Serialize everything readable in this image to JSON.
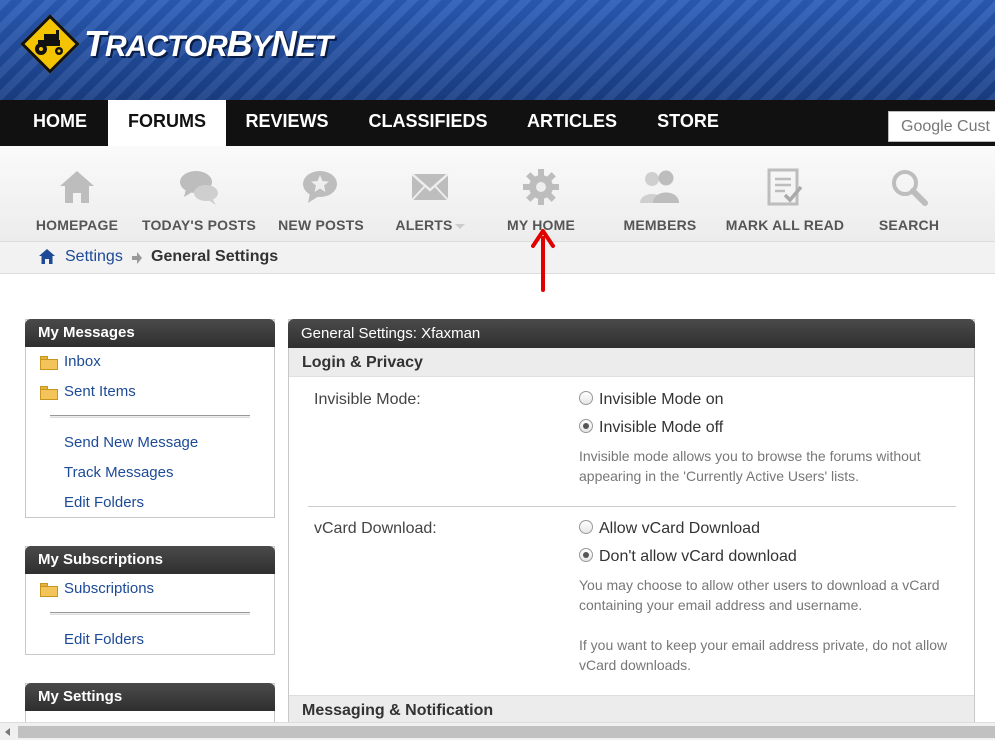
{
  "header": {
    "logo_text_prefix": "T",
    "logo_text_mid": "RACTOR",
    "logo_text_b": "B",
    "logo_text_y": "Y",
    "logo_text_n": "N",
    "logo_text_et": "ET"
  },
  "topnav": {
    "tabs": [
      {
        "label": "HOME"
      },
      {
        "label": "FORUMS",
        "active": true
      },
      {
        "label": "REVIEWS"
      },
      {
        "label": "CLASSIFIEDS"
      },
      {
        "label": "ARTICLES"
      },
      {
        "label": "STORE"
      }
    ],
    "search_placeholder": "Google Cust"
  },
  "subnav": {
    "items": [
      {
        "label": "HOMEPAGE",
        "icon": "house-icon"
      },
      {
        "label": "TODAY'S POSTS",
        "icon": "chat-bubbles-icon"
      },
      {
        "label": "NEW POSTS",
        "icon": "star-bubble-icon"
      },
      {
        "label": "ALERTS",
        "icon": "envelope-icon"
      },
      {
        "label": "MY HOME",
        "icon": "gear-icon"
      },
      {
        "label": "MEMBERS",
        "icon": "members-icon"
      },
      {
        "label": "MARK ALL READ",
        "icon": "clipboard-check-icon"
      },
      {
        "label": "SEARCH",
        "icon": "magnifier-icon"
      }
    ]
  },
  "breadcrumb": {
    "items": [
      "Settings",
      "General Settings"
    ]
  },
  "sidebar": {
    "messages": {
      "title": "My Messages",
      "folders": [
        "Inbox",
        "Sent Items"
      ],
      "links": [
        "Send New Message",
        "Track Messages",
        "Edit Folders"
      ]
    },
    "subscriptions": {
      "title": "My Subscriptions",
      "folders": [
        "Subscriptions"
      ],
      "links": [
        "Edit Folders"
      ]
    },
    "settings": {
      "title": "My Settings"
    }
  },
  "main": {
    "title": "General Settings: Xfaxman",
    "section1": "Login & Privacy",
    "invisible": {
      "label": "Invisible Mode:",
      "opt_on": "Invisible Mode on",
      "opt_off": "Invisible Mode off",
      "desc": "Invisible mode allows you to browse the forums without appearing in the 'Currently Active Users' lists."
    },
    "vcard": {
      "label": "vCard Download:",
      "opt_allow": "Allow vCard Download",
      "opt_deny": "Don't allow vCard download",
      "desc1": "You may choose to allow other users to download a vCard containing your email address and username.",
      "desc2": "If you want to keep your email address private, do not allow vCard downloads."
    },
    "section2": "Messaging & Notification"
  }
}
